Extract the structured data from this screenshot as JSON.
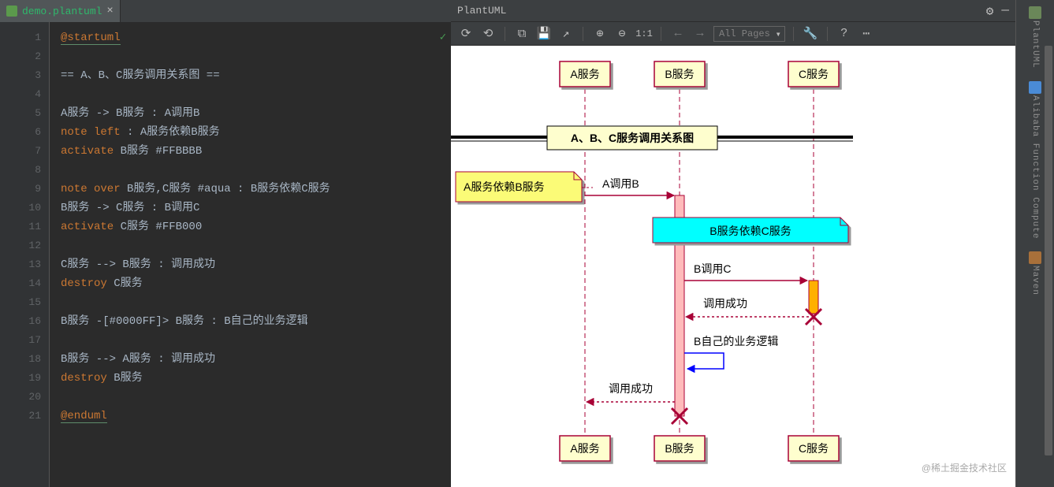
{
  "tab": {
    "filename": "demo.plantuml"
  },
  "gutterLines": [
    "1",
    "2",
    "3",
    "4",
    "5",
    "6",
    "7",
    "8",
    "9",
    "10",
    "11",
    "12",
    "13",
    "14",
    "15",
    "16",
    "17",
    "18",
    "19",
    "20",
    "21"
  ],
  "code": [
    [
      [
        "dir",
        "@startuml"
      ]
    ],
    [],
    [
      [
        "txt",
        "== A、B、C服务调用关系图 =="
      ]
    ],
    [],
    [
      [
        "txt",
        "A服务 -> B服务 : A调用B"
      ]
    ],
    [
      [
        "kw",
        "note left"
      ],
      [
        "txt",
        " : A服务依赖B服务"
      ]
    ],
    [
      [
        "kw",
        "activate"
      ],
      [
        "txt",
        " B服务 #FFBBBB"
      ]
    ],
    [],
    [
      [
        "kw",
        "note over"
      ],
      [
        "txt",
        " B服务,C服务 "
      ],
      [
        "hex",
        "#aqua"
      ],
      [
        "txt",
        " : B服务依赖C服务"
      ]
    ],
    [
      [
        "txt",
        "B服务 -> C服务 : B调用C"
      ]
    ],
    [
      [
        "kw",
        "activate"
      ],
      [
        "txt",
        " C服务 #FFB000"
      ]
    ],
    [],
    [
      [
        "txt",
        "C服务 --> B服务 : 调用成功"
      ]
    ],
    [
      [
        "kw",
        "destroy"
      ],
      [
        "txt",
        " C服务"
      ]
    ],
    [],
    [
      [
        "txt",
        "B服务 -[#0000FF]> B服务 : B自己的业务逻辑"
      ]
    ],
    [],
    [
      [
        "txt",
        "B服务 --> A服务 : 调用成功"
      ]
    ],
    [
      [
        "kw",
        "destroy"
      ],
      [
        "txt",
        " B服务"
      ]
    ],
    [],
    [
      [
        "dir",
        "@enduml"
      ]
    ]
  ],
  "rightPanel": {
    "title": "PlantUML",
    "pagesCombo": "All Pages"
  },
  "diagram": {
    "actors": {
      "a": "A服务",
      "b": "B服务",
      "c": "C服务"
    },
    "title": "A、B、C服务调用关系图",
    "noteLeft": "A服务依赖B服务",
    "noteOver": "B服务依赖C服务",
    "msgs": {
      "m1": "A调用B",
      "m2": "B调用C",
      "m3": "调用成功",
      "m4": "B自己的业务逻辑",
      "m5": "调用成功"
    },
    "colors": {
      "activationB": "#FFBBBB",
      "activationC": "#FFB000",
      "noteBg": "#FBFB77",
      "aqua": "#00FFFF"
    }
  },
  "sidebarRight": {
    "plantuml": "PlantUML",
    "fc": "Alibaba Function Compute",
    "maven": "Maven"
  },
  "watermark": "@稀土掘金技术社区"
}
